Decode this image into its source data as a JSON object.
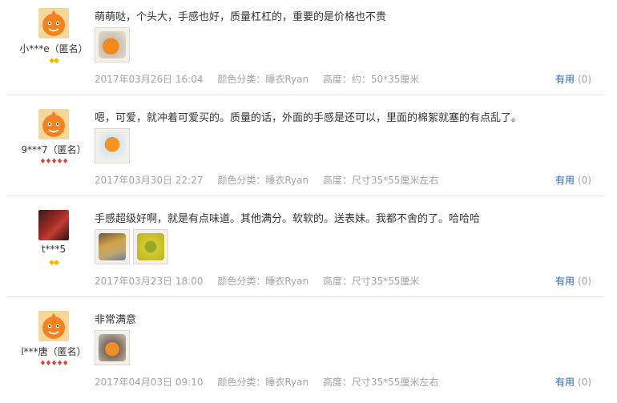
{
  "reviews": [
    {
      "user": "小***e（匿名）",
      "avatar": "tmall-default-avatar",
      "level_icon": "gold-diamond-icon",
      "level_color": "#f3b600",
      "badges": "◆◆",
      "content": "萌萌哒，个头大，手感也好，质量杠杠的，重要的是价格也不贵",
      "photos": [
        "review-photo"
      ],
      "date": "2017年03月26日 16:04",
      "color_spec": "颜色分类：睡衣Ryan",
      "height_spec": "高度：约：50*35厘米",
      "helpful_label": "有用",
      "helpful_count": "(0)"
    },
    {
      "user": "9***7（匿名）",
      "avatar": "tmall-default-avatar",
      "level_icon": "red-heart-icon",
      "level_color": "#e0413b",
      "badges": "♦♦♦♦♦",
      "content": "嗯，可爱，就冲着可爱买的。质量的话，外面的手感是还可以，里面的棉絮就塞的有点乱了。",
      "photos": [
        "review-photo"
      ],
      "date": "2017年03月30日 22:27",
      "color_spec": "颜色分类：睡衣Ryan",
      "height_spec": "高度：尺寸35*55厘米左右",
      "helpful_label": "有用",
      "helpful_count": "(0)"
    },
    {
      "user": "t***5",
      "avatar": "user-photo-avatar",
      "level_icon": "gold-diamond-icon",
      "level_color": "#f3b600",
      "badges": "◆◆",
      "content": "手感超级好啊，就是有点味道。其他满分。软软的。送表妹。我都不舍的了。哈哈哈",
      "photos": [
        "review-photo",
        "review-photo"
      ],
      "date": "2017年03月23日 18:00",
      "color_spec": "颜色分类：睡衣Ryan",
      "height_spec": "高度：尺寸35*55厘米",
      "helpful_label": "有用",
      "helpful_count": "(0)"
    },
    {
      "user": "l***唐（匿名）",
      "avatar": "tmall-default-avatar",
      "level_icon": "red-heart-icon",
      "level_color": "#e0413b",
      "badges": "♦♦♦♦♦",
      "content": "非常满意",
      "photos": [
        "review-photo"
      ],
      "date": "2017年04月03日 09:10",
      "color_spec": "颜色分类：睡衣Ryan",
      "height_spec": "高度：尺寸35*55厘米左右",
      "helpful_label": "有用",
      "helpful_count": "(0)"
    }
  ]
}
